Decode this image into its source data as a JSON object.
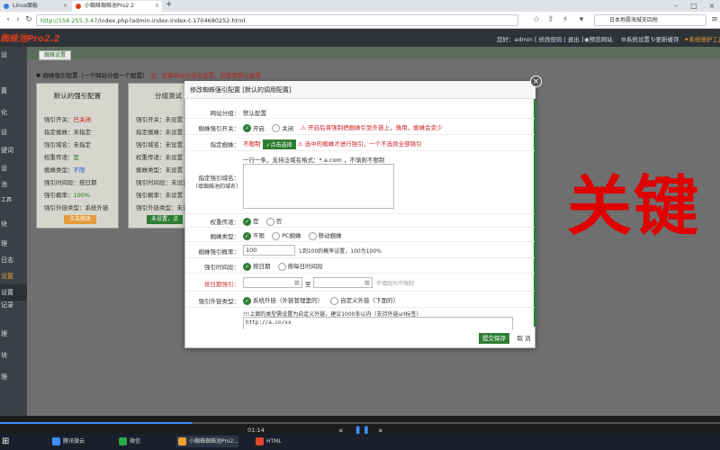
{
  "browser": {
    "tabs": [
      {
        "label": "Linux面板"
      },
      {
        "label": "小蜘蛛蜘蛛池Pro2.2"
      }
    ],
    "new_tab": "+",
    "url_prefix": "http://156.255.3.47",
    "url_rest": "/index.php?admin-index-index-t-1704680252.html",
    "search_text": "日本地震海城支四抢"
  },
  "app": {
    "logo": "蜘蛛池Pro2.2",
    "header_links": [
      "您好：admin",
      "[ 修改密码 | 退出 ]",
      "预览网站",
      "系统设置",
      "更新缓存",
      "系统维护工具"
    ],
    "tab": "蜘蛛设置",
    "info_prefix": "蜘蛛强引配置（一个网站分组一个配置）",
    "info_note": "注：如果网站分组未设置，则使用默认配置",
    "sidebar": [
      "设",
      "置",
      "化",
      "设",
      "键词",
      "设",
      "",
      "池",
      "工具",
      "块",
      "理",
      "日志",
      "设置",
      "设置",
      "记录",
      "理",
      "块",
      "理"
    ]
  },
  "card1": {
    "title": "默认的强引配置",
    "lines": [
      {
        "k": "强引开关：",
        "v": "已关闭"
      },
      {
        "k": "指定蜘蛛：",
        "v": "未指定"
      },
      {
        "k": "强引域名：",
        "v": "未指定"
      },
      {
        "k": "权重传递：",
        "v": "是"
      },
      {
        "k": "蜘蛛类型：",
        "v": "不限"
      },
      {
        "k": "强引时间段：",
        "v": "按日期"
      },
      {
        "k": "强引概率：",
        "v": "100%"
      },
      {
        "k": "强引外链类型：",
        "v": "系统外链"
      }
    ],
    "button": "点击修改"
  },
  "card2": {
    "title": "分组测试",
    "lines": [
      {
        "k": "强引开关：",
        "v": "未设置"
      },
      {
        "k": "指定蜘蛛：",
        "v": "未设置"
      },
      {
        "k": "强引域名：",
        "v": "未设置"
      },
      {
        "k": "权重传递：",
        "v": "未设置"
      },
      {
        "k": "蜘蛛类型：",
        "v": "未设置"
      },
      {
        "k": "强引时间段：",
        "v": "未设置"
      },
      {
        "k": "强引概率：",
        "v": "未设置"
      },
      {
        "k": "强引外链类型：",
        "v": "未设置"
      }
    ],
    "button1": "未设置，点",
    "button2": "点"
  },
  "overlay_text": "关键",
  "modal": {
    "title": "修改蜘蛛强引配置 [默认的调用配置]",
    "close": "×",
    "rows": {
      "group_label": "网站分组：",
      "group_value": "默认配置",
      "switch_label": "蜘蛛强引开关：",
      "switch_on": "开启",
      "switch_off": "关闭",
      "switch_warn": "开启后将强制把蜘蛛引到外链上，慎用，蜘蛛会变少",
      "spider_label": "指定蜘蛛：",
      "spider_value": "不限制",
      "spider_btn": "点击选择",
      "spider_warn": "选中的蜘蛛才进行强引，一个不选则全部强引",
      "domain_label": "指定强引域名：",
      "domain_sub": "（填蜘蛛池的域名）",
      "domain_hint": "一行一条，支持泛域名格式：*.a.com ，不填则不限制",
      "weight_label": "权重传递：",
      "weight_yes": "是",
      "weight_no": "否",
      "type_label": "蜘蛛类型：",
      "type_1": "不限",
      "type_2": "PC蜘蛛",
      "type_3": "移动蜘蛛",
      "prob_label": "蜘蛛强引概率：",
      "prob_value": "100",
      "prob_hint": "1到100的概率设置，100为100%",
      "time_label": "强引时间段：",
      "time_1": "按日期",
      "time_2": "按每日时间段",
      "date_label": "按日期强引：",
      "date_to": "至",
      "date_hint": "不填则为不限制",
      "link_label": "强引外链类型：",
      "link_1": "系统外链（外链管理里的）",
      "link_2": "自定义外链（下面的）",
      "link_hint": "!!!上面的类型需设置为自定义外链，建议1000条以内（支持外链url标签）",
      "link_value": "http://a.cn/xx"
    },
    "save": "提交保存",
    "cancel": "取 消"
  },
  "player": {
    "time": "01:14"
  },
  "taskbar": [
    "腾讯微云",
    "微信",
    "小蜘蛛蜘蛛池Pro2...",
    "HTML"
  ]
}
